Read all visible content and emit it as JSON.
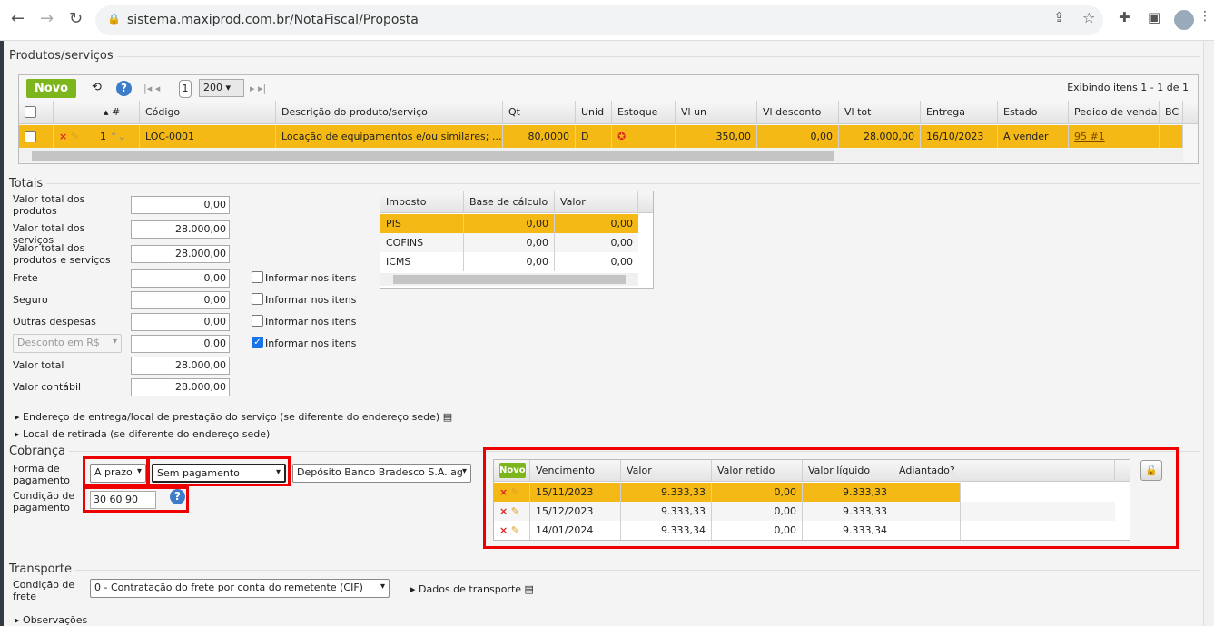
{
  "browser": {
    "url": "sistema.maxiprod.com.br/NotaFiscal/Proposta"
  },
  "produtos": {
    "section_title": "Produtos/serviços",
    "novo_label": "Novo",
    "page": "1",
    "page_size": "200",
    "exibindo": "Exibindo itens 1 - 1 de 1",
    "columns": [
      "#",
      "Código",
      "Descrição do produto/serviço",
      "Qt",
      "Unid",
      "Estoque",
      "Vl un",
      "Vl desconto",
      "Vl tot",
      "Entrega",
      "Estado",
      "Pedido de venda",
      "BC"
    ],
    "rows": [
      {
        "num": "1",
        "codigo": "LOC-0001",
        "descricao": "Locação de equipamentos e/ou similares; ...",
        "qt": "80,0000",
        "unid": "D",
        "vl_un": "350,00",
        "vl_desconto": "0,00",
        "vl_tot": "28.000,00",
        "entrega": "16/10/2023",
        "estado": "A vender",
        "pedido": "95 #1"
      }
    ]
  },
  "totais": {
    "section_title": "Totais",
    "fields": [
      {
        "label": "Valor total dos produtos",
        "value": "0,00"
      },
      {
        "label": "Valor total dos serviços",
        "value": "28.000,00"
      },
      {
        "label": "Valor total dos produtos e serviços",
        "value": "28.000,00"
      },
      {
        "label": "Frete",
        "value": "0,00"
      },
      {
        "label": "Seguro",
        "value": "0,00"
      },
      {
        "label": "Outras despesas",
        "value": "0,00"
      },
      {
        "label": "Desconto em R$",
        "value": "0,00"
      },
      {
        "label": "Valor total",
        "value": "28.000,00"
      },
      {
        "label": "Valor contábil",
        "value": "28.000,00"
      }
    ],
    "informar_label": "Informar nos itens",
    "impostos_columns": [
      "Imposto",
      "Base de cálculo",
      "Valor"
    ],
    "impostos": [
      {
        "imposto": "PIS",
        "base": "0,00",
        "valor": "0,00"
      },
      {
        "imposto": "COFINS",
        "base": "0,00",
        "valor": "0,00"
      },
      {
        "imposto": "ICMS",
        "base": "0,00",
        "valor": "0,00"
      }
    ]
  },
  "endereco_entrega": "Endereço de entrega/local de prestação do serviço (se diferente do endereço sede)",
  "local_retirada": "Local de retirada (se diferente do endereço sede)",
  "cobranca": {
    "section_title": "Cobrança",
    "forma_label": "Forma de pagamento",
    "forma_value": "A prazo",
    "meio_value": "Sem pagamento",
    "conta_value": "Depósito Banco Bradesco S.A. ag",
    "condicao_label": "Condição de pagamento",
    "condicao_value": "30 60 90",
    "novo_label": "Novo",
    "columns": [
      "Vencimento",
      "Valor",
      "Valor retido",
      "Valor líquido",
      "Adiantado?"
    ],
    "parcelas": [
      {
        "vencimento": "15/11/2023",
        "valor": "9.333,33",
        "retido": "0,00",
        "liquido": "9.333,33"
      },
      {
        "vencimento": "15/12/2023",
        "valor": "9.333,33",
        "retido": "0,00",
        "liquido": "9.333,33"
      },
      {
        "vencimento": "14/01/2024",
        "valor": "9.333,34",
        "retido": "0,00",
        "liquido": "9.333,34"
      }
    ]
  },
  "transporte": {
    "section_title": "Transporte",
    "condicao_label": "Condição de frete",
    "condicao_value": "0 - Contratação do frete por conta do remetente (CIF)",
    "dados_label": "Dados de transporte"
  },
  "observacoes": "Observações",
  "colors": {
    "selected": "#f4b914",
    "novo": "#7db51c",
    "highlight": "#e00000"
  }
}
